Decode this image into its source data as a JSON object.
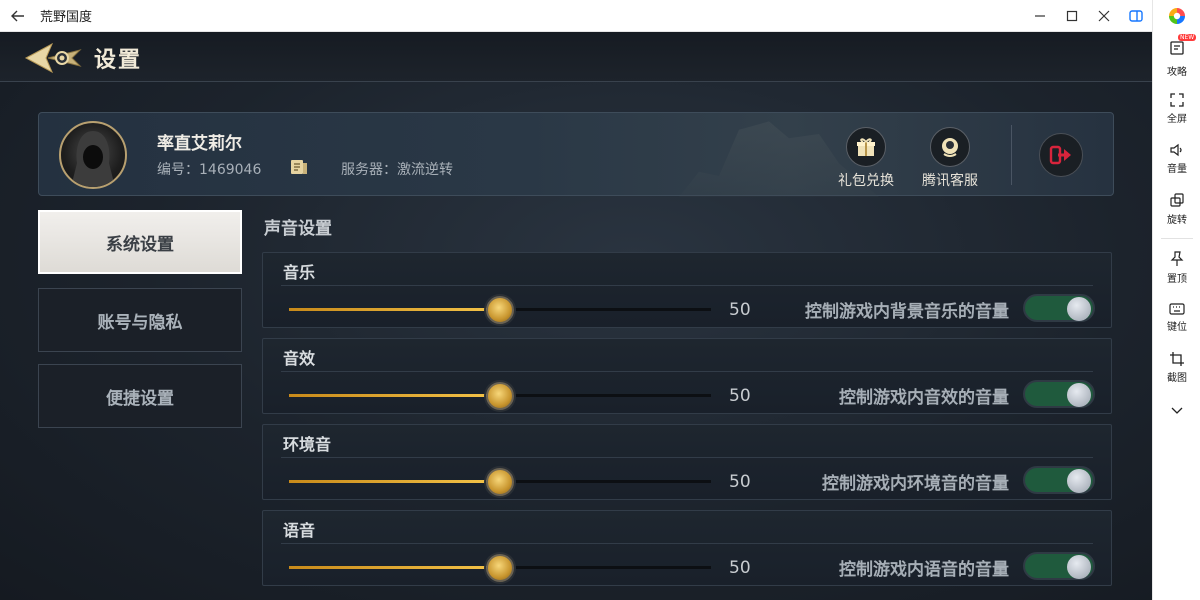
{
  "window": {
    "title": "荒野国度"
  },
  "sidebar": {
    "items": [
      {
        "label": "攻略",
        "badge": "NEW",
        "icon": "guide-icon"
      },
      {
        "label": "全屏",
        "icon": "fullscreen-icon"
      },
      {
        "label": "音量",
        "icon": "volume-icon"
      },
      {
        "label": "旋转",
        "icon": "rotate-icon"
      },
      {
        "label": "置顶",
        "icon": "pin-icon"
      },
      {
        "label": "键位",
        "icon": "keyboard-icon"
      },
      {
        "label": "截图",
        "icon": "crop-icon"
      }
    ]
  },
  "game": {
    "page_title": "设置",
    "profile": {
      "name": "率直艾莉尔",
      "id_text": "编号：1469046",
      "server_text": "服务器：激流逆转",
      "buttons": [
        {
          "label": "礼包兑换",
          "icon": "gift-icon"
        },
        {
          "label": "腾讯客服",
          "icon": "customer-service-icon"
        }
      ]
    },
    "menu": [
      {
        "label": "系统设置",
        "active": true
      },
      {
        "label": "账号与隐私",
        "active": false
      },
      {
        "label": "便捷设置",
        "active": false
      }
    ],
    "section_title": "声音设置",
    "sound": [
      {
        "name": "音乐",
        "value": "50",
        "level": 0.5,
        "description": "控制游戏内背景音乐的音量",
        "enabled": true
      },
      {
        "name": "音效",
        "value": "50",
        "level": 0.5,
        "description": "控制游戏内音效的音量",
        "enabled": true
      },
      {
        "name": "环境音",
        "value": "50",
        "level": 0.5,
        "description": "控制游戏内环境音的音量",
        "enabled": true
      },
      {
        "name": "语音",
        "value": "50",
        "level": 0.5,
        "description": "控制游戏内语音的音量",
        "enabled": true
      }
    ]
  },
  "colors": {
    "accent_gold": "#f5c54a",
    "toggle_on": "#1f5a3d",
    "logout_red": "#d8243c"
  }
}
